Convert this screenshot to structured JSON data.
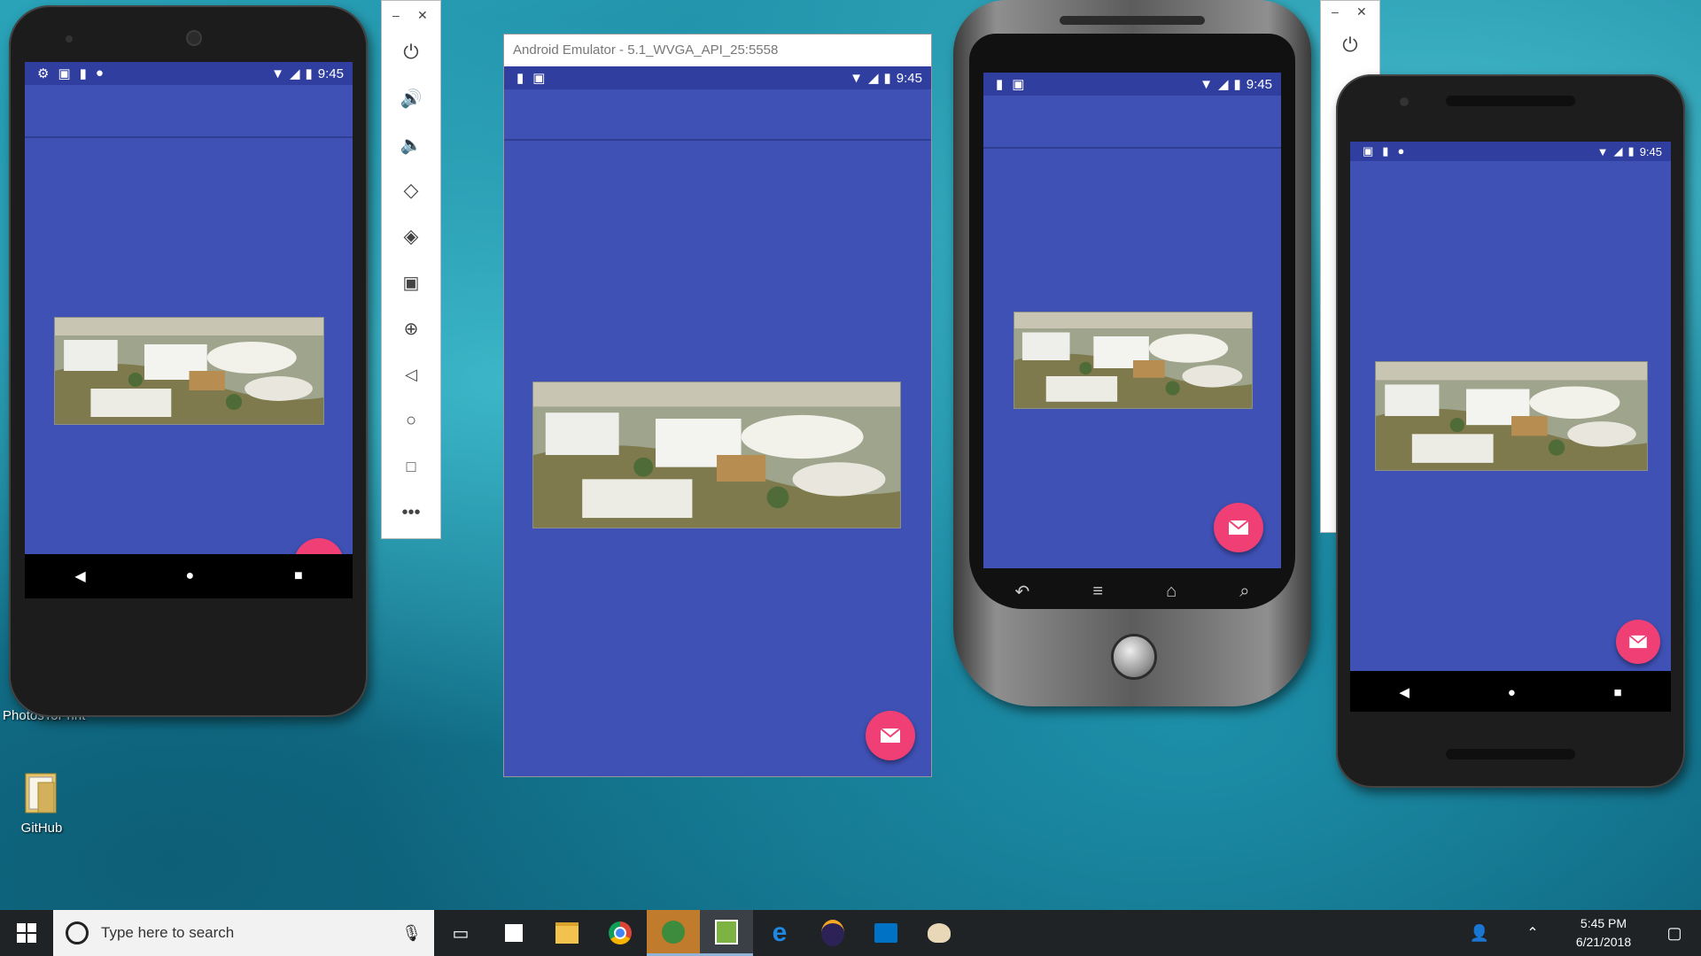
{
  "emulators": {
    "status_time": "9:45",
    "window_title": "Android Emulator - 5.1_WVGA_API_25:5558"
  },
  "desktop": {
    "icons": [
      {
        "label": "PhotosToPrint"
      },
      {
        "label": "GitHub"
      }
    ]
  },
  "taskbar": {
    "search_placeholder": "Type here to search",
    "time": "5:45 PM",
    "date": "6/21/2018"
  },
  "colors": {
    "app_primary": "#3f51b5",
    "fab": "#ef3f75",
    "taskbar": "#1f2326"
  }
}
